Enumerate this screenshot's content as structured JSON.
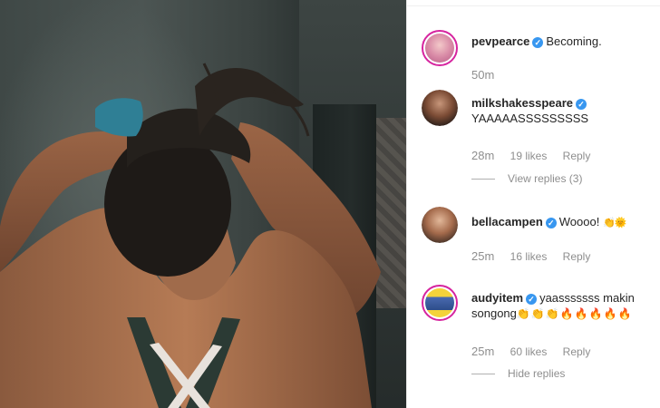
{
  "comments": [
    {
      "username": "pevpearce",
      "verified": true,
      "text": "Becoming.",
      "time": "50m"
    },
    {
      "username": "milkshakesspeare",
      "verified": true,
      "text": "YAAAAASSSSSSSSS",
      "time": "28m",
      "likes": "19 likes",
      "reply_label": "Reply",
      "replies_toggle": "View replies (3)"
    },
    {
      "username": "bellacampen",
      "verified": true,
      "text": "Woooo!",
      "emoji": "👏🌞",
      "time": "25m",
      "likes": "16 likes",
      "reply_label": "Reply"
    },
    {
      "username": "audyitem",
      "verified": true,
      "text": "yaasssssss makin songong",
      "emoji": "👏👏👏🔥🔥🔥🔥🔥",
      "time": "25m",
      "likes": "60 likes",
      "reply_label": "Reply",
      "replies_toggle": "Hide replies"
    }
  ],
  "colors": {
    "verified": "#3897f0",
    "meta_text": "#8e8e8e",
    "username": "#262626",
    "story_ring": "#d6249f"
  }
}
